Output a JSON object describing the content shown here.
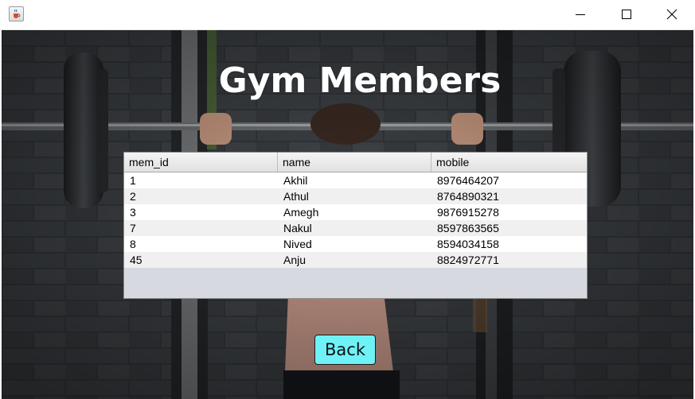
{
  "window": {
    "controls": {
      "minimize": "minimize-icon",
      "maximize": "maximize-icon",
      "close": "close-icon"
    },
    "app_icon": "java-cup-icon"
  },
  "page": {
    "title": "Gym Members"
  },
  "table": {
    "columns": [
      "mem_id",
      "name",
      "mobile"
    ],
    "rows": [
      [
        "1",
        "Akhil",
        "8976464207"
      ],
      [
        "2",
        "Athul",
        "8764890321"
      ],
      [
        "3",
        "Amegh",
        "9876915278"
      ],
      [
        "7",
        "Nakul",
        "8597863565"
      ],
      [
        "8",
        "Nived",
        "8594034158"
      ],
      [
        "45",
        "Anju",
        "8824972771"
      ]
    ]
  },
  "actions": {
    "back_label": "Back"
  },
  "colors": {
    "back_button": "#6ff2f7",
    "heading_text": "#ffffff",
    "table_empty_area": "#d6d9df"
  }
}
